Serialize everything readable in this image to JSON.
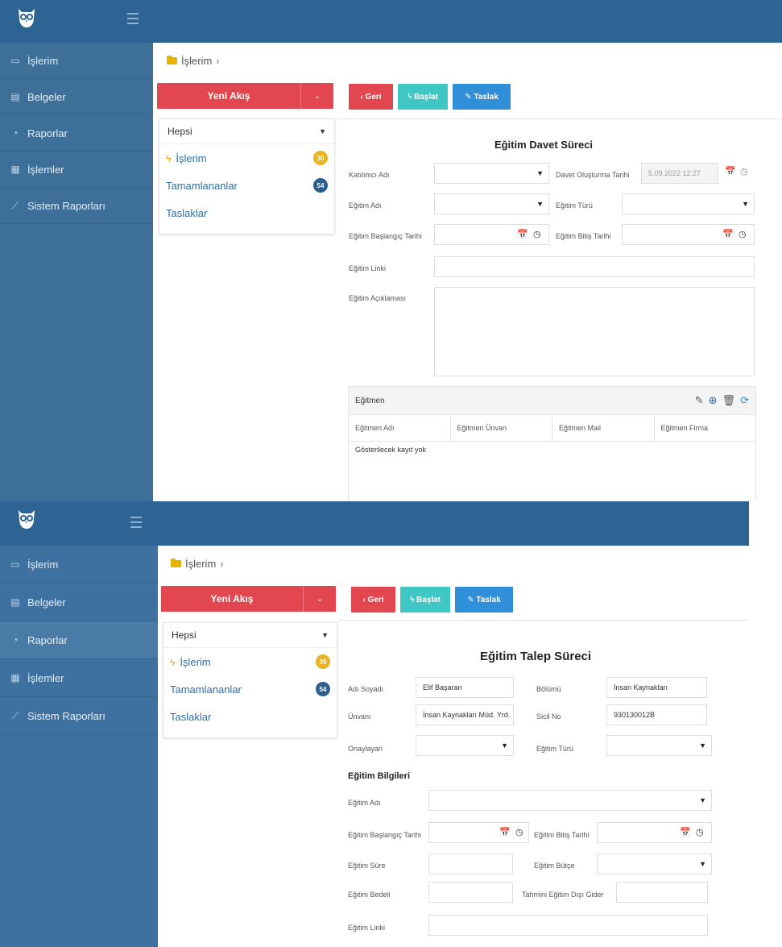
{
  "screen1": {
    "sidebar": [
      {
        "label": "İşlerim",
        "icon": "inbox-icon"
      },
      {
        "label": "Belgeler",
        "icon": "document-icon"
      },
      {
        "label": "Raporlar",
        "icon": "pie-chart-icon"
      },
      {
        "label": "İşlemler",
        "icon": "list-icon"
      },
      {
        "label": "Sistem Raporları",
        "icon": "line-chart-icon"
      }
    ],
    "breadcrumb": {
      "label": "İşlerim",
      "separator": "›"
    },
    "new_flow": "Yeni Akış",
    "filter": {
      "selected": "Hepsi"
    },
    "flow_items": [
      {
        "label": "İşlerim",
        "count": "30"
      },
      {
        "label": "Tamamlananlar",
        "count": "54"
      },
      {
        "label": "Taslaklar"
      }
    ],
    "toolbar": {
      "back": "‹ Geri",
      "start": "ϟ Başlat",
      "draft": "✎ Taslak"
    },
    "form": {
      "title": "Eğitim Davet Süreci",
      "participant_label": "Katılımcı Adı",
      "invite_date_label": "Davet Oluşturma Tarihi",
      "invite_date_value": "5.09.2022 12:27",
      "training_name_label": "Eğitim Adı",
      "training_type_label": "Eğitim Türü",
      "start_date_label": "Eğitim Başlangıç Tarihi",
      "end_date_label": "Eğitim Bitiş Tarihi",
      "link_label": "Eğitim Linki",
      "description_label": "Eğitim Açıklaması"
    },
    "trainer": {
      "title": "Eğitmen",
      "columns": [
        "Eğitmen Adı",
        "Eğitmen Ünvan",
        "Eğitmen Mail",
        "Eğitmen Firma"
      ],
      "empty": "Gösterilecek kayıt yok"
    }
  },
  "screen2": {
    "sidebar": [
      {
        "label": "İşlerim",
        "icon": "inbox-icon"
      },
      {
        "label": "Belgeler",
        "icon": "document-icon"
      },
      {
        "label": "Raporlar",
        "icon": "pie-chart-icon"
      },
      {
        "label": "İşlemler",
        "icon": "list-icon"
      },
      {
        "label": "Sistem Raporları",
        "icon": "line-chart-icon"
      }
    ],
    "breadcrumb": {
      "label": "İşlerim",
      "separator": "›"
    },
    "new_flow": "Yeni Akış",
    "filter": {
      "selected": "Hepsi"
    },
    "flow_items": [
      {
        "label": "İşlerim",
        "count": "30"
      },
      {
        "label": "Tamamlananlar",
        "count": "54"
      },
      {
        "label": "Taslaklar"
      }
    ],
    "toolbar": {
      "back": "‹ Geri",
      "start": "ϟ Başlat",
      "draft": "✎ Taslak"
    },
    "form": {
      "title": "Eğitim Talep Süreci",
      "name_label": "Adı Soyadı",
      "name_value": "Elif Başaran",
      "dept_label": "Bölümü",
      "dept_value": "İnsan Kaynakları",
      "title_label": "Ünvanı",
      "title_value": "İnsan Kaynakları Müd. Yrd.",
      "reg_label": "Sicil No",
      "reg_value": "930130012B",
      "approver_label": "Onaylayan",
      "type_label": "Eğitim Türü",
      "section": "Eğitim Bilgileri",
      "training_name_label": "Eğitim Adı",
      "start_label": "Eğitim Başlangıç Tarihi",
      "end_label": "Eğitim Bitiş Tarihi",
      "duration_label": "Eğitim Süre",
      "budget_label": "Eğitim Bütçe",
      "cost_label": "Eğitim Bedeli",
      "extra_cost_label": "Tahmini Eğitim Dışı Gider",
      "link_label": "Eğitim Linki"
    }
  }
}
